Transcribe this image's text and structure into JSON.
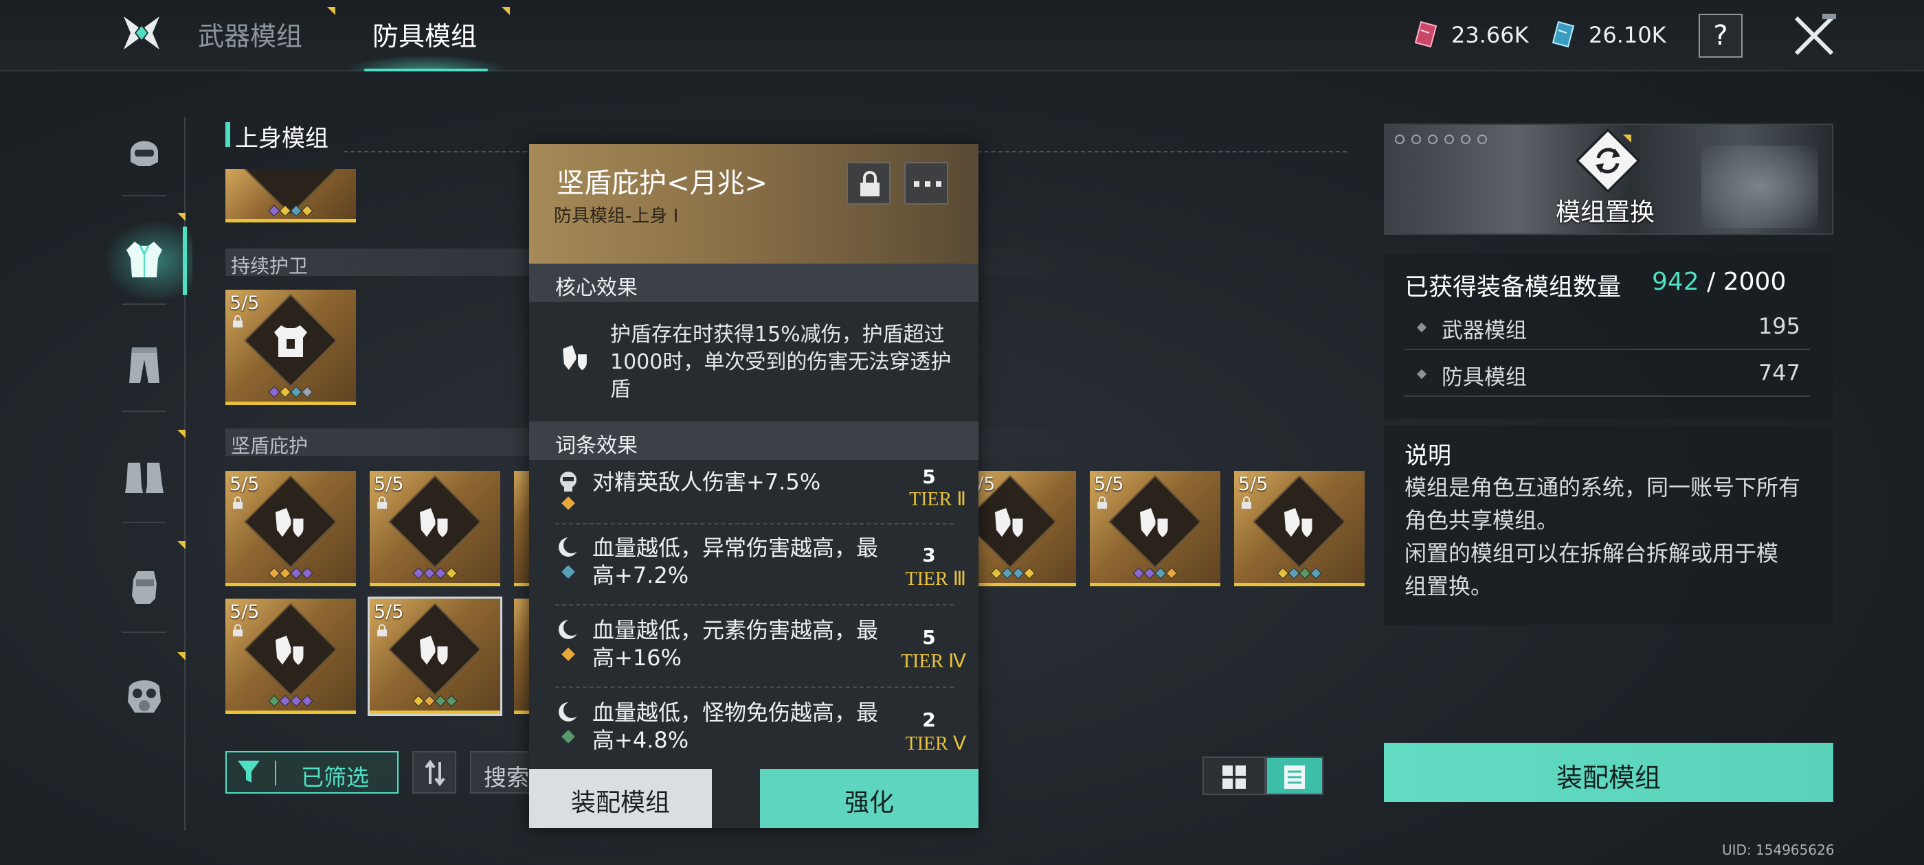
{
  "header": {
    "tabs": [
      {
        "label": "武器模组",
        "active": false
      },
      {
        "label": "防具模组",
        "active": true
      }
    ],
    "currencies": [
      {
        "icon": "crimson-crystal-icon",
        "value": "23.66K",
        "color": "#d0506e"
      },
      {
        "icon": "teal-crystal-icon",
        "value": "26.10K",
        "color": "#4fb8d8"
      }
    ],
    "help_label": "?"
  },
  "sidebar": {
    "items": [
      {
        "icon": "helmet-icon",
        "active": false
      },
      {
        "icon": "armor-vest-icon",
        "active": true
      },
      {
        "icon": "pants-icon",
        "active": false
      },
      {
        "icon": "boots-icon",
        "active": false
      },
      {
        "icon": "gloves-icon",
        "active": false
      },
      {
        "icon": "gas-mask-icon",
        "active": false
      }
    ]
  },
  "grid": {
    "section_title": "上身模组",
    "groups": [
      {
        "label": "持续护卫"
      },
      {
        "label": "坚盾庇护"
      }
    ],
    "cards": [
      {
        "count": "5/5",
        "icon": "body-armor-icon",
        "dots": [
          "#8a6ad0",
          "#e8c23a",
          "#5aa0b8",
          "#9aa4ac"
        ]
      },
      {
        "count": "5/5",
        "icon": "shield-mod-icon",
        "dots": [
          "#e8a83a",
          "#e8a83a",
          "#8a6ad0",
          "#8a6ad0"
        ]
      },
      {
        "count": "5/5",
        "icon": "shield-mod-icon",
        "dots": [
          "#8a6ad0",
          "#8a6ad0",
          "#8a6ad0",
          "#e8c23a"
        ]
      },
      {
        "count": "5/5",
        "icon": "shield-mod-icon",
        "dots": [
          "#e8c23a",
          "#5aa0b8",
          "#5aa0b8",
          "#e8c23a"
        ]
      },
      {
        "count": "5/5",
        "icon": "shield-mod-icon",
        "dots": [
          "#8a6ad0",
          "#8a6ad0",
          "#5aa0b8",
          "#e8a83a"
        ]
      },
      {
        "count": "5/5",
        "icon": "shield-mod-icon",
        "dots": [
          "#e8c23a",
          "#5aa0b8",
          "#5a9a6a",
          "#5aa0b8"
        ]
      },
      {
        "count": "5/5",
        "icon": "shield-mod-icon",
        "dots": [
          "#5a9a6a",
          "#8a6ad0",
          "#8a6ad0",
          "#8a6ad0"
        ]
      },
      {
        "count": "5/5",
        "icon": "shield-mod-icon",
        "dots": [
          "#e8c23a",
          "#e8a83a",
          "#5a9a6a",
          "#5a9a6a"
        ]
      }
    ],
    "filter_label": "已筛选",
    "search_label": "搜索"
  },
  "popup": {
    "title": "坚盾庇护<月兆>",
    "subtitle": "防具模组-上身 Ⅰ",
    "core_section": "核心效果",
    "core_text": "护盾存在时获得15%减伤，护盾超过1000时，单次受到的伤害无法穿透护盾",
    "affix_section": "词条效果",
    "affixes": [
      {
        "icon": "elite-enemy-icon",
        "gem": "#e8a83a",
        "text_line1": "对精英敌人伤害+7.5%",
        "text_line2": "",
        "num": "5",
        "tier": "TIER Ⅱ"
      },
      {
        "icon": "crescent-icon",
        "gem": "#5aa0b8",
        "text_line1": "血量越低，异常伤害越高，最",
        "text_line2": "高+7.2%",
        "num": "3",
        "tier": "TIER Ⅲ"
      },
      {
        "icon": "crescent-icon",
        "gem": "#e8a83a",
        "text_line1": "血量越低，元素伤害越高，最",
        "text_line2": "高+16%",
        "num": "5",
        "tier": "TIER Ⅳ"
      },
      {
        "icon": "crescent-icon",
        "gem": "#5a9a6a",
        "text_line1": "血量越低，怪物免伤越高，最",
        "text_line2": "高+4.8%",
        "num": "2",
        "tier": "TIER Ⅴ"
      }
    ],
    "equip_label": "装配模组",
    "enhance_label": "强化"
  },
  "right_panel": {
    "banner_label": "模组置换",
    "stat_title": "已获得装备模组数量",
    "stat_current": "942",
    "stat_sep_total": "/ 2000",
    "rows": [
      {
        "label": "武器模组",
        "value": "195"
      },
      {
        "label": "防具模组",
        "value": "747"
      }
    ],
    "desc_title": "说明",
    "desc_line1": "模组是角色互通的系统，同一账号下所有",
    "desc_line2": "角色共享模组。",
    "desc_line3": "闲置的模组可以在拆解台拆解或用于模",
    "desc_line4": "组置换。",
    "equip_label": "装配模组"
  },
  "uid": "UID: 154965626",
  "colors": {
    "accent": "#4fe0c4",
    "gold": "#e8c23a",
    "card_gold": "#b48a4a"
  }
}
